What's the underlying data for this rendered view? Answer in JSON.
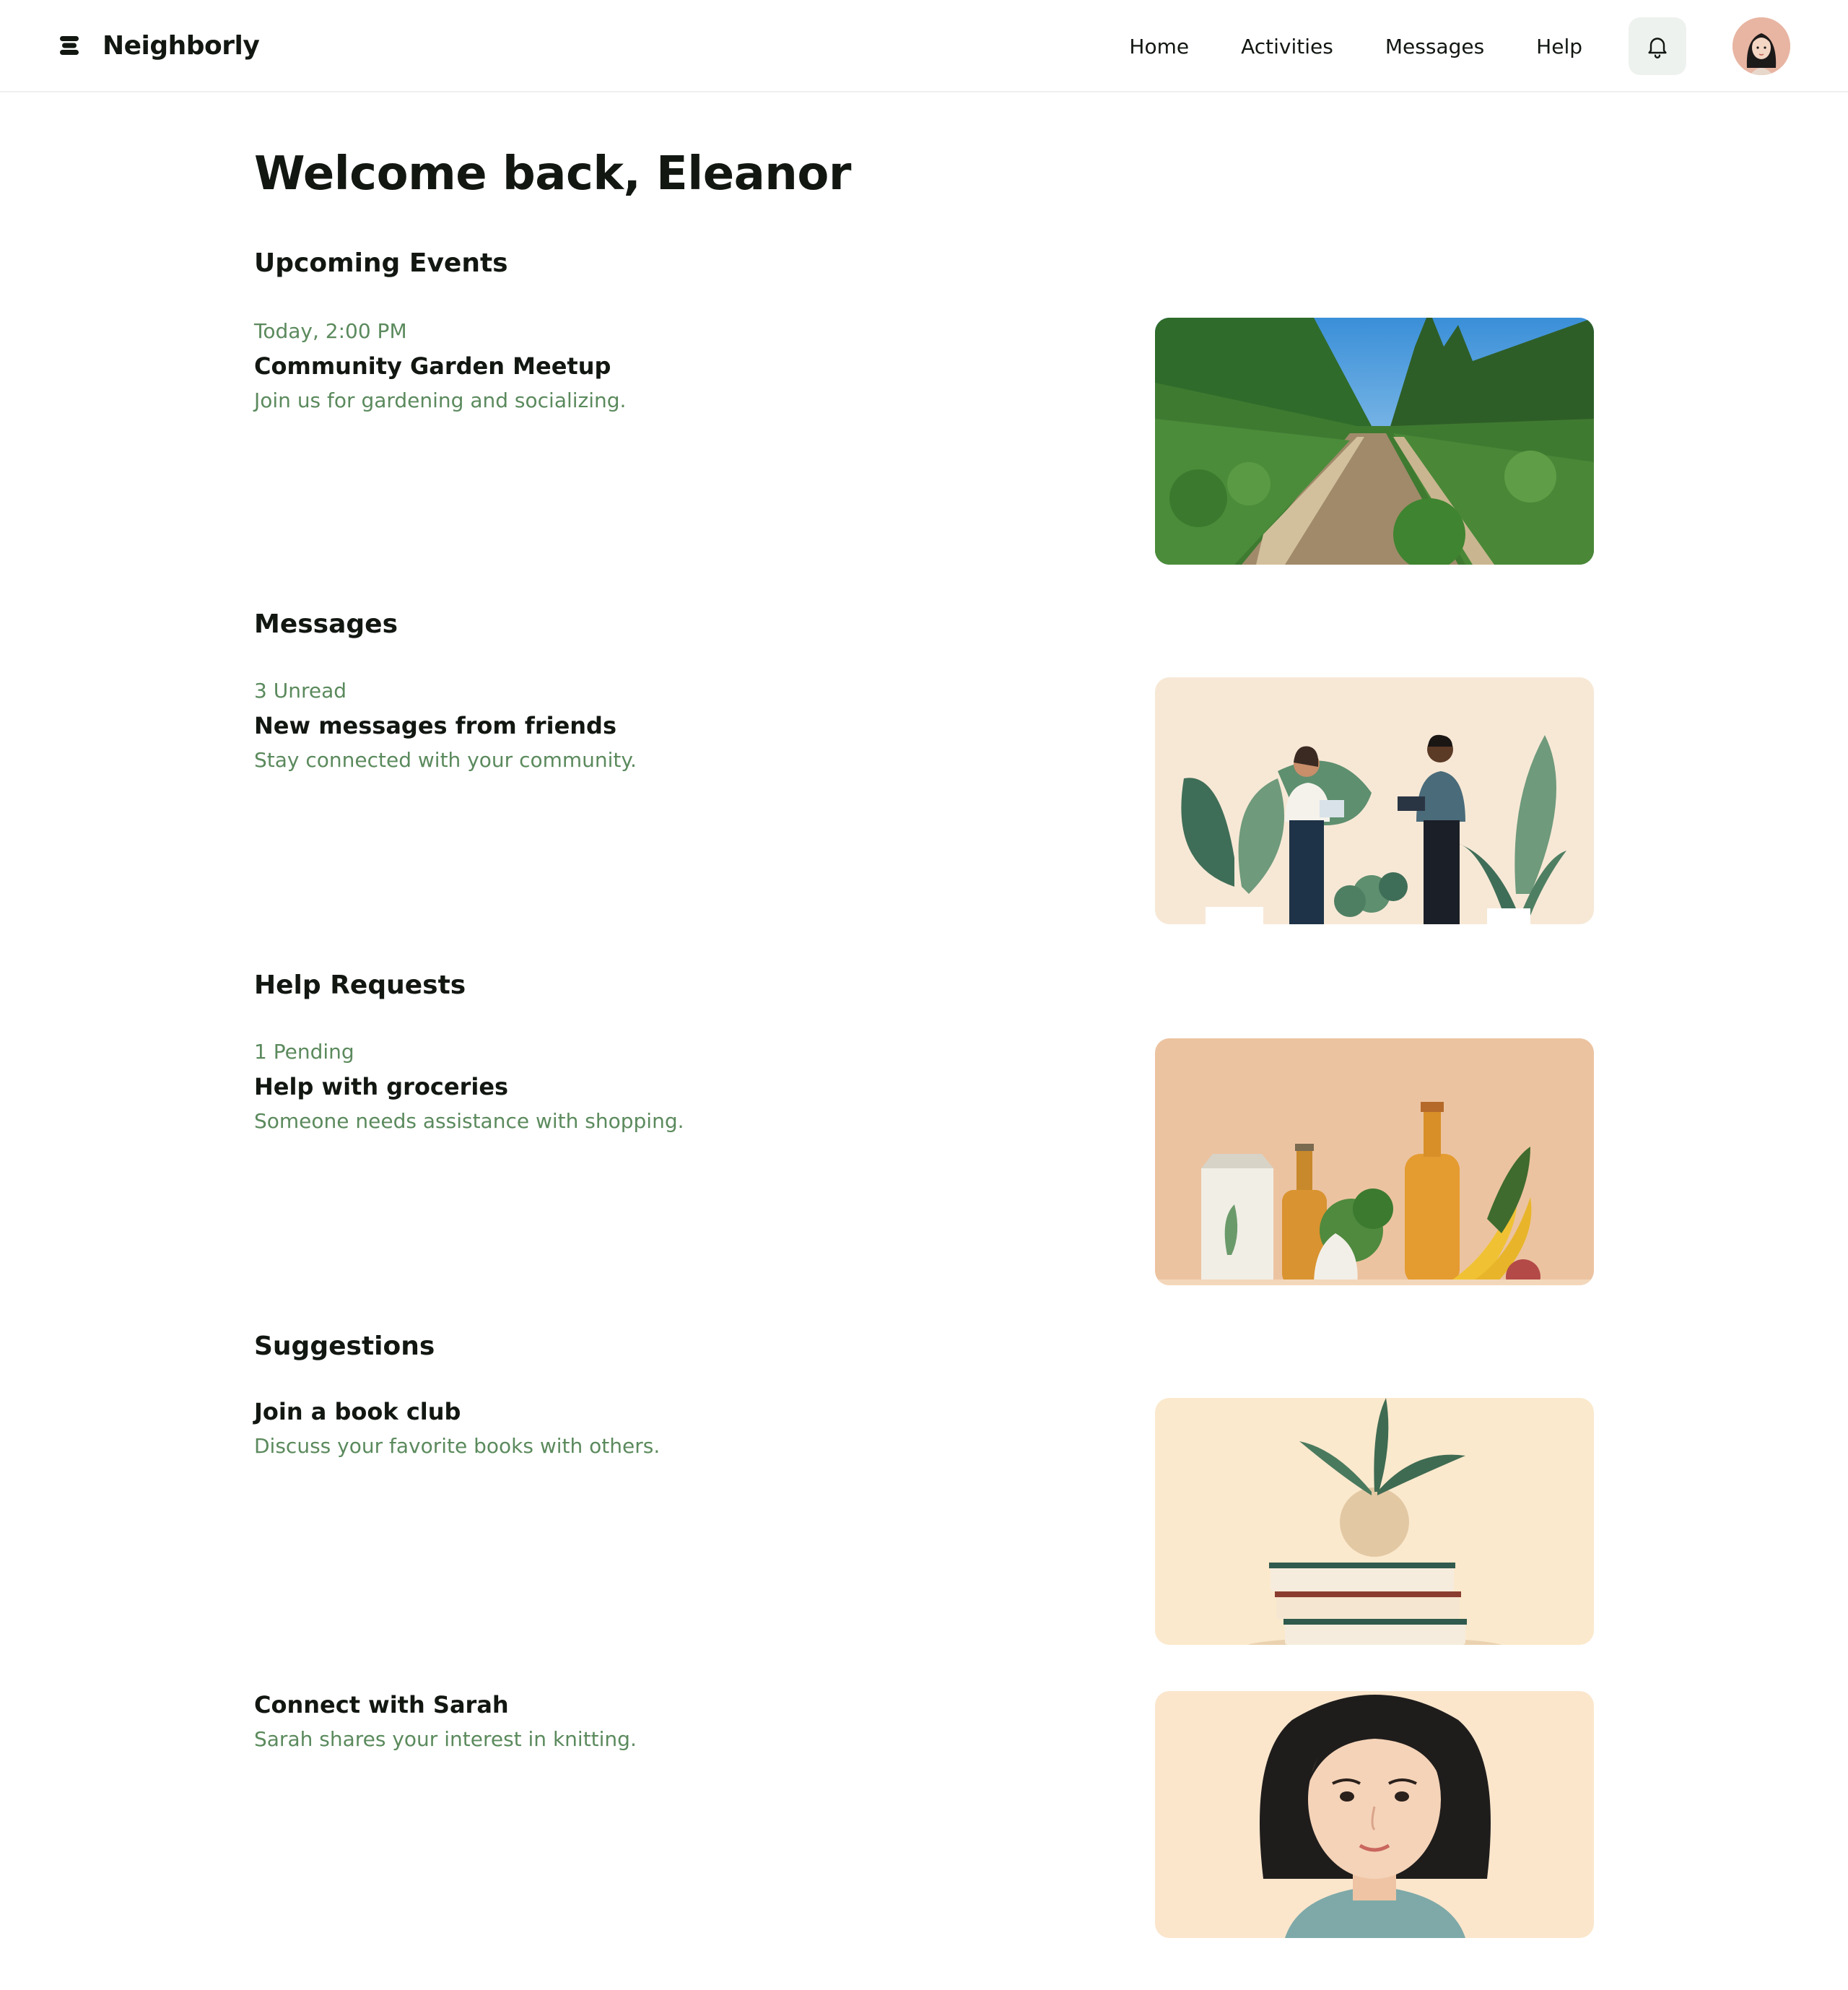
{
  "app": {
    "name": "Neighborly"
  },
  "nav": {
    "home": "Home",
    "activities": "Activities",
    "messages": "Messages",
    "help": "Help"
  },
  "page": {
    "title": "Welcome back, Eleanor"
  },
  "sections": {
    "events": {
      "title": "Upcoming Events",
      "meta": "Today, 2:00 PM",
      "item_title": "Community Garden Meetup",
      "item_desc": "Join us for gardening and socializing."
    },
    "messages": {
      "title": "Messages",
      "meta": "3 Unread",
      "item_title": "New messages from friends",
      "item_desc": "Stay connected with your community."
    },
    "help": {
      "title": "Help Requests",
      "meta": "1 Pending",
      "item_title": "Help with groceries",
      "item_desc": "Someone needs assistance with shopping."
    },
    "suggestions": {
      "title": "Suggestions",
      "items": [
        {
          "title": "Join a book club",
          "desc": "Discuss your favorite books with others."
        },
        {
          "title": "Connect with Sarah",
          "desc": "Sarah shares your interest in knitting."
        }
      ]
    }
  },
  "icons": {
    "bell": "bell-icon",
    "logo": "neighborly-logo-icon"
  },
  "colors": {
    "accent_text": "#5b8a5d",
    "bell_bg": "#eef2ef",
    "heading": "#121712"
  }
}
